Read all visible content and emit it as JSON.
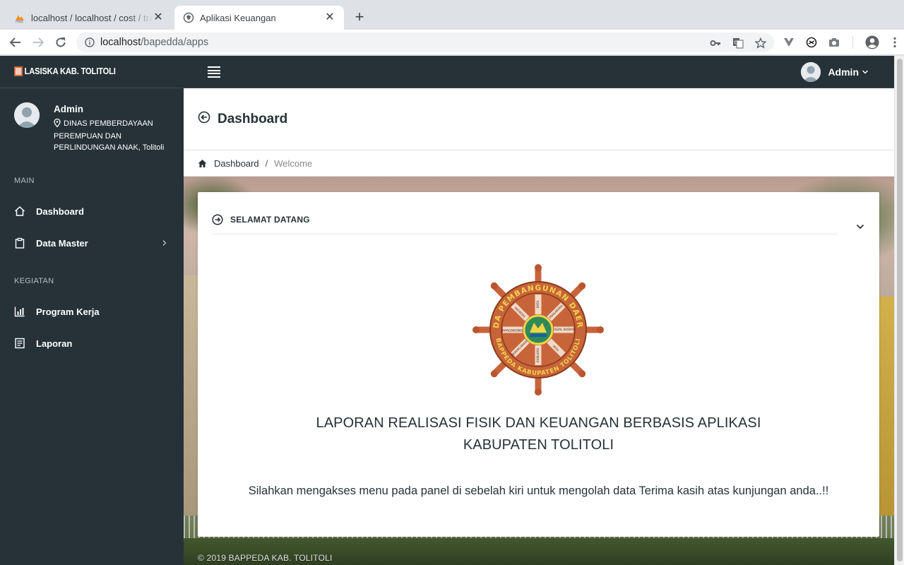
{
  "browser": {
    "tabs": [
      {
        "title": "localhost / localhost / cost / transaksi",
        "favicon": "phpmyadmin-icon",
        "active": false
      },
      {
        "title": "Aplikasi Keuangan",
        "favicon": "globe-icon",
        "active": true
      }
    ],
    "address": {
      "host": "localhost",
      "path": "/bapedda/apps"
    }
  },
  "app": {
    "brand": "LASISKA KAB. TOLITOLI",
    "user_menu": {
      "name": "Admin"
    },
    "sidebar": {
      "profile": {
        "name": "Admin",
        "org": "DINAS PEMBERDAYAAN PEREMPUAN DAN PERLINDUNGAN ANAK, Tolitoli"
      },
      "sections": [
        {
          "label": "MAIN",
          "items": [
            {
              "label": "Dashboard",
              "icon": "home-icon"
            },
            {
              "label": "Data Master",
              "icon": "clipboard-icon",
              "has_submenu": true
            }
          ]
        },
        {
          "label": "KEGIATAN",
          "items": [
            {
              "label": "Program Kerja",
              "icon": "bar-chart-icon"
            },
            {
              "label": "Laporan",
              "icon": "document-icon"
            }
          ]
        }
      ]
    },
    "page": {
      "title": "Dashboard",
      "breadcrumb": {
        "home": "Dashboard",
        "separator": "/",
        "current": "Welcome"
      }
    },
    "card": {
      "title": "SELAMAT DATANG",
      "headline_line1": "LAPORAN REALISASI FISIK DAN KEUANGAN BERBASIS APLIKASI",
      "headline_line2": "KABUPATEN TOLITOLI",
      "message": "Silahkan mengakses menu pada panel di sebelah kiri untuk mengolah data Terima kasih atas kunjungan anda..!!",
      "logo": {
        "ring_text_top": "RODA PEMBANGUNAN DAERAH",
        "ring_text_bottom": "BAPPEDA KABUPATEN TOLITOLI",
        "spokes": [
          "DATA",
          "PRASARANA",
          "SOSIAL BUDAYA",
          "FISIK",
          "EVALUASI",
          "PERENCANAAN",
          "PEMERINTAHAN",
          "EKONOMI"
        ]
      }
    },
    "footer": "© 2019 BAPPEDA KAB. TOLITOLI"
  },
  "colors": {
    "sidebar_bg": "#263238",
    "logo_wheel": "#c8643a",
    "logo_ring_text": "#f3d34a"
  }
}
